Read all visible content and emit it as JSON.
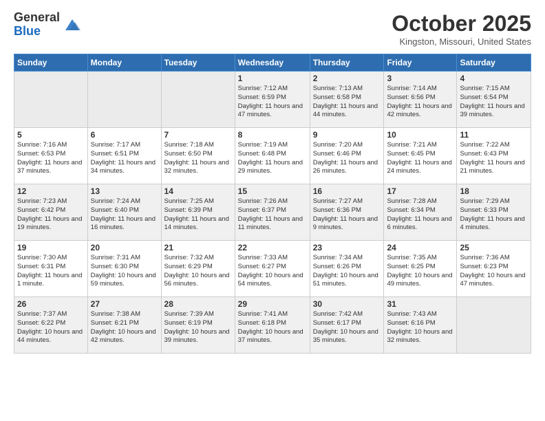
{
  "logo": {
    "general": "General",
    "blue": "Blue"
  },
  "header": {
    "month": "October 2025",
    "location": "Kingston, Missouri, United States"
  },
  "days_of_week": [
    "Sunday",
    "Monday",
    "Tuesday",
    "Wednesday",
    "Thursday",
    "Friday",
    "Saturday"
  ],
  "weeks": [
    [
      {
        "day": "",
        "info": ""
      },
      {
        "day": "",
        "info": ""
      },
      {
        "day": "",
        "info": ""
      },
      {
        "day": "1",
        "info": "Sunrise: 7:12 AM\nSunset: 6:59 PM\nDaylight: 11 hours and 47 minutes."
      },
      {
        "day": "2",
        "info": "Sunrise: 7:13 AM\nSunset: 6:58 PM\nDaylight: 11 hours and 44 minutes."
      },
      {
        "day": "3",
        "info": "Sunrise: 7:14 AM\nSunset: 6:56 PM\nDaylight: 11 hours and 42 minutes."
      },
      {
        "day": "4",
        "info": "Sunrise: 7:15 AM\nSunset: 6:54 PM\nDaylight: 11 hours and 39 minutes."
      }
    ],
    [
      {
        "day": "5",
        "info": "Sunrise: 7:16 AM\nSunset: 6:53 PM\nDaylight: 11 hours and 37 minutes."
      },
      {
        "day": "6",
        "info": "Sunrise: 7:17 AM\nSunset: 6:51 PM\nDaylight: 11 hours and 34 minutes."
      },
      {
        "day": "7",
        "info": "Sunrise: 7:18 AM\nSunset: 6:50 PM\nDaylight: 11 hours and 32 minutes."
      },
      {
        "day": "8",
        "info": "Sunrise: 7:19 AM\nSunset: 6:48 PM\nDaylight: 11 hours and 29 minutes."
      },
      {
        "day": "9",
        "info": "Sunrise: 7:20 AM\nSunset: 6:46 PM\nDaylight: 11 hours and 26 minutes."
      },
      {
        "day": "10",
        "info": "Sunrise: 7:21 AM\nSunset: 6:45 PM\nDaylight: 11 hours and 24 minutes."
      },
      {
        "day": "11",
        "info": "Sunrise: 7:22 AM\nSunset: 6:43 PM\nDaylight: 11 hours and 21 minutes."
      }
    ],
    [
      {
        "day": "12",
        "info": "Sunrise: 7:23 AM\nSunset: 6:42 PM\nDaylight: 11 hours and 19 minutes."
      },
      {
        "day": "13",
        "info": "Sunrise: 7:24 AM\nSunset: 6:40 PM\nDaylight: 11 hours and 16 minutes."
      },
      {
        "day": "14",
        "info": "Sunrise: 7:25 AM\nSunset: 6:39 PM\nDaylight: 11 hours and 14 minutes."
      },
      {
        "day": "15",
        "info": "Sunrise: 7:26 AM\nSunset: 6:37 PM\nDaylight: 11 hours and 11 minutes."
      },
      {
        "day": "16",
        "info": "Sunrise: 7:27 AM\nSunset: 6:36 PM\nDaylight: 11 hours and 9 minutes."
      },
      {
        "day": "17",
        "info": "Sunrise: 7:28 AM\nSunset: 6:34 PM\nDaylight: 11 hours and 6 minutes."
      },
      {
        "day": "18",
        "info": "Sunrise: 7:29 AM\nSunset: 6:33 PM\nDaylight: 11 hours and 4 minutes."
      }
    ],
    [
      {
        "day": "19",
        "info": "Sunrise: 7:30 AM\nSunset: 6:31 PM\nDaylight: 11 hours and 1 minute."
      },
      {
        "day": "20",
        "info": "Sunrise: 7:31 AM\nSunset: 6:30 PM\nDaylight: 10 hours and 59 minutes."
      },
      {
        "day": "21",
        "info": "Sunrise: 7:32 AM\nSunset: 6:29 PM\nDaylight: 10 hours and 56 minutes."
      },
      {
        "day": "22",
        "info": "Sunrise: 7:33 AM\nSunset: 6:27 PM\nDaylight: 10 hours and 54 minutes."
      },
      {
        "day": "23",
        "info": "Sunrise: 7:34 AM\nSunset: 6:26 PM\nDaylight: 10 hours and 51 minutes."
      },
      {
        "day": "24",
        "info": "Sunrise: 7:35 AM\nSunset: 6:25 PM\nDaylight: 10 hours and 49 minutes."
      },
      {
        "day": "25",
        "info": "Sunrise: 7:36 AM\nSunset: 6:23 PM\nDaylight: 10 hours and 47 minutes."
      }
    ],
    [
      {
        "day": "26",
        "info": "Sunrise: 7:37 AM\nSunset: 6:22 PM\nDaylight: 10 hours and 44 minutes."
      },
      {
        "day": "27",
        "info": "Sunrise: 7:38 AM\nSunset: 6:21 PM\nDaylight: 10 hours and 42 minutes."
      },
      {
        "day": "28",
        "info": "Sunrise: 7:39 AM\nSunset: 6:19 PM\nDaylight: 10 hours and 39 minutes."
      },
      {
        "day": "29",
        "info": "Sunrise: 7:41 AM\nSunset: 6:18 PM\nDaylight: 10 hours and 37 minutes."
      },
      {
        "day": "30",
        "info": "Sunrise: 7:42 AM\nSunset: 6:17 PM\nDaylight: 10 hours and 35 minutes."
      },
      {
        "day": "31",
        "info": "Sunrise: 7:43 AM\nSunset: 6:16 PM\nDaylight: 10 hours and 32 minutes."
      },
      {
        "day": "",
        "info": ""
      }
    ]
  ]
}
